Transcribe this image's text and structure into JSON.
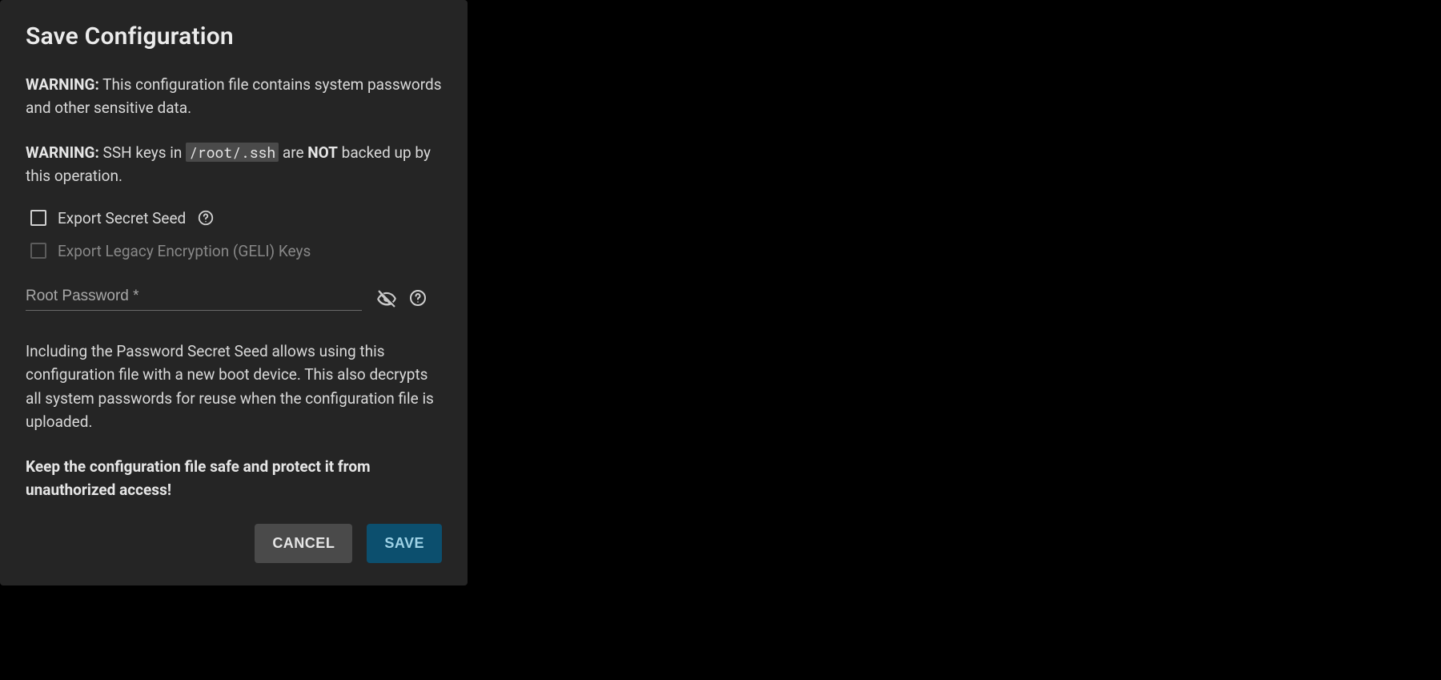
{
  "dialog": {
    "title": "Save Configuration",
    "warning1_prefix": "WARNING:",
    "warning1_body": " This configuration file contains system passwords and other sensitive data.",
    "warning2_prefix": "WARNING:",
    "warning2_body1": " SSH keys in ",
    "warning2_path": "/root/.ssh",
    "warning2_body2": " are ",
    "warning2_not": "NOT",
    "warning2_body3": " backed up by this operation.",
    "checkbox1_label": "Export Secret Seed",
    "checkbox2_label": "Export Legacy Encryption (GELI) Keys",
    "password_placeholder": "Root Password *",
    "info_para": "Including the Password Secret Seed allows using this configuration file with a new boot device. This also decrypts all system passwords for reuse when the configuration file is uploaded.",
    "keep_safe": "Keep the configuration file safe and protect it from unauthorized access!",
    "cancel_label": "Cancel",
    "save_label": "Save"
  }
}
